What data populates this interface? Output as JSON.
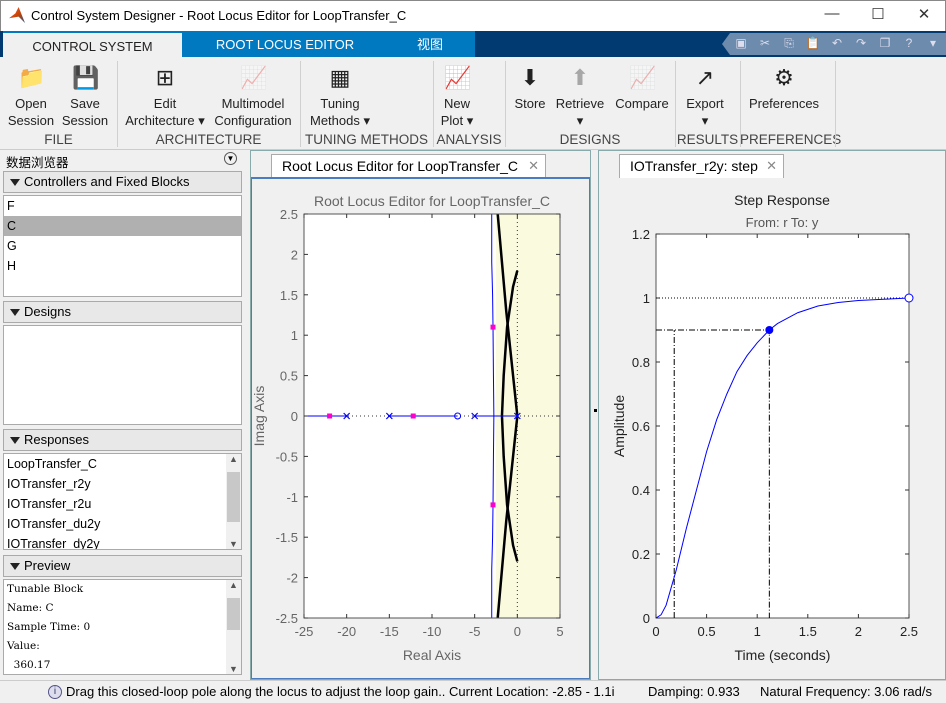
{
  "window": {
    "title": "Control System Designer - Root Locus Editor for LoopTransfer_C",
    "minimize": "—",
    "maximize": "☐",
    "close": "✕"
  },
  "tabs": [
    {
      "label": "CONTROL SYSTEM",
      "active": true
    },
    {
      "label": "ROOT LOCUS EDITOR"
    },
    {
      "label": "视图"
    }
  ],
  "quick_access": [
    "save-icon",
    "cut-icon",
    "copy-icon",
    "paste-icon",
    "undo-icon",
    "redo-icon",
    "window-icon",
    "help-icon",
    "menu-icon"
  ],
  "ribbon": {
    "buttons": [
      {
        "id": "open-session",
        "l1": "Open",
        "l2": "Session",
        "icon": "📁"
      },
      {
        "id": "save-session",
        "l1": "Save",
        "l2": "Session",
        "icon": "💾"
      },
      {
        "id": "edit-architecture",
        "l1": "Edit",
        "l2": "Architecture ▾",
        "icon": "⊞"
      },
      {
        "id": "multimodel-configuration",
        "l1": "Multimodel",
        "l2": "Configuration",
        "icon": "📈",
        "disabled": true
      },
      {
        "id": "tuning-methods",
        "l1": "Tuning",
        "l2": "Methods ▾",
        "icon": "▦"
      },
      {
        "id": "new-plot",
        "l1": "New",
        "l2": "Plot ▾",
        "icon": "📈"
      },
      {
        "id": "store",
        "l1": "Store",
        "l2": "",
        "icon": "⬇"
      },
      {
        "id": "retrieve",
        "l1": "Retrieve",
        "l2": "▾",
        "icon": "⬆",
        "disabled": true
      },
      {
        "id": "compare",
        "l1": "Compare",
        "l2": "",
        "icon": "📈",
        "disabled": true
      },
      {
        "id": "export",
        "l1": "Export",
        "l2": "▾",
        "icon": "↗"
      },
      {
        "id": "preferences",
        "l1": "Preferences",
        "l2": "",
        "icon": "⚙"
      }
    ],
    "groups": [
      "FILE",
      "ARCHITECTURE",
      "TUNING METHODS",
      "ANALYSIS",
      "DESIGNS",
      "RESULTS",
      "PREFERENCES"
    ]
  },
  "browser": {
    "title": "数据浏览器",
    "controllers": {
      "title": "Controllers and Fixed Blocks",
      "items": [
        "F",
        "C",
        "G",
        "H"
      ],
      "selected": "C"
    },
    "designs": {
      "title": "Designs"
    },
    "responses": {
      "title": "Responses",
      "items": [
        "LoopTransfer_C",
        "IOTransfer_r2y",
        "IOTransfer_r2u",
        "IOTransfer_du2y",
        "IOTransfer_dy2y"
      ]
    },
    "preview": {
      "title": "Preview",
      "lines": [
        "Tunable Block",
        "Name: C",
        "Sample Time: 0",
        "Value:",
        "  360.17"
      ]
    }
  },
  "docs": {
    "rl_tab": "Root Locus Editor for LoopTransfer_C",
    "step_tab": "IOTransfer_r2y: step",
    "close": "✕"
  },
  "chart_data": [
    {
      "type": "scatter",
      "title": "Root Locus Editor for LoopTransfer_C",
      "xlabel": "Real Axis",
      "ylabel": "Imag Axis",
      "xlim": [
        -25,
        5
      ],
      "ylim": [
        -2.5,
        2.5
      ],
      "xticks": [
        "-25",
        "-20",
        "-15",
        "-10",
        "-5",
        "0",
        "5"
      ],
      "yticks": [
        "-2.5",
        "-2",
        "-1.5",
        "-1",
        "-0.5",
        "0",
        "0.5",
        "1",
        "1.5",
        "2",
        "2.5"
      ],
      "open_loop_poles": [
        [
          0,
          0
        ],
        [
          -5,
          0
        ],
        [
          -15,
          0
        ],
        [
          -20,
          0
        ]
      ],
      "open_loop_zeros": [
        [
          -7,
          0
        ]
      ],
      "closed_loop_poles": [
        [
          -22,
          0
        ],
        [
          -12.2,
          0
        ],
        [
          -2.85,
          1.1
        ],
        [
          -2.85,
          -1.1
        ]
      ],
      "unstable_region_color": "#fafade",
      "pole_color": "#0000ff",
      "closed_loop_color": "#ff00cc",
      "blue_locus": [
        [
          [
            -25,
            0
          ],
          [
            -20,
            0
          ]
        ],
        [
          [
            -15,
            0
          ],
          [
            -7,
            0
          ]
        ],
        [
          [
            -5,
            0
          ],
          [
            0,
            0
          ]
        ],
        [
          [
            -3,
            2.5
          ],
          [
            -3,
            1.9
          ],
          [
            -2.9,
            1.5
          ],
          [
            -2.85,
            1.1
          ],
          [
            -2.8,
            0.5
          ],
          [
            -2.75,
            0
          ],
          [
            -2.8,
            -0.5
          ],
          [
            -2.85,
            -1.1
          ],
          [
            -2.9,
            -1.5
          ],
          [
            -3,
            -1.9
          ],
          [
            -3,
            -2.5
          ]
        ]
      ],
      "constraint_branches": [
        [
          [
            -2.3,
            2.5
          ],
          [
            -1.8,
            1.9
          ],
          [
            -1.3,
            1.3
          ],
          [
            -0.7,
            0.7
          ],
          [
            -0.2,
            0.2
          ],
          [
            0,
            0
          ]
        ],
        [
          [
            -2.3,
            -2.5
          ],
          [
            -1.8,
            -1.9
          ],
          [
            -1.3,
            -1.3
          ],
          [
            -0.7,
            -0.7
          ],
          [
            -0.2,
            -0.2
          ],
          [
            0,
            0
          ]
        ],
        [
          [
            0,
            1.8
          ],
          [
            -0.5,
            1.6
          ],
          [
            -1.2,
            1.1
          ],
          [
            -1.6,
            0.5
          ],
          [
            -1.8,
            0
          ],
          [
            -1.6,
            -0.5
          ],
          [
            -1.2,
            -1.1
          ],
          [
            -0.5,
            -1.6
          ],
          [
            0,
            -1.8
          ]
        ]
      ]
    },
    {
      "type": "line",
      "title": "Step Response",
      "subtitle": "From: r  To: y",
      "xlabel": "Time (seconds)",
      "ylabel": "Amplitude",
      "xlim": [
        0,
        2.5
      ],
      "ylim": [
        0,
        1.2
      ],
      "xticks": [
        "0",
        "0.5",
        "1",
        "1.5",
        "2",
        "2.5"
      ],
      "yticks": [
        "0",
        "0.2",
        "0.4",
        "0.6",
        "0.8",
        "1",
        "1.2"
      ],
      "color": "#0000ff",
      "x": [
        0,
        0.05,
        0.1,
        0.2,
        0.3,
        0.4,
        0.5,
        0.6,
        0.7,
        0.8,
        0.9,
        1.0,
        1.12,
        1.2,
        1.4,
        1.6,
        1.8,
        2.0,
        2.25,
        2.5
      ],
      "y": [
        0,
        0.01,
        0.04,
        0.15,
        0.28,
        0.4,
        0.52,
        0.62,
        0.7,
        0.77,
        0.82,
        0.86,
        0.9,
        0.92,
        0.954,
        0.975,
        0.986,
        0.992,
        0.996,
        1.0
      ],
      "rise_time_marker": {
        "t_start": 0.18,
        "t_end": 1.12,
        "level": 0.9
      },
      "steady_state": 1
    }
  ],
  "status": {
    "message": "Drag this closed-loop pole along the locus to adjust the loop gain.. Current Location: -2.85 - 1.1i",
    "damping": "Damping: 0.933",
    "natural_frequency": "Natural Frequency: 3.06 rad/s"
  }
}
